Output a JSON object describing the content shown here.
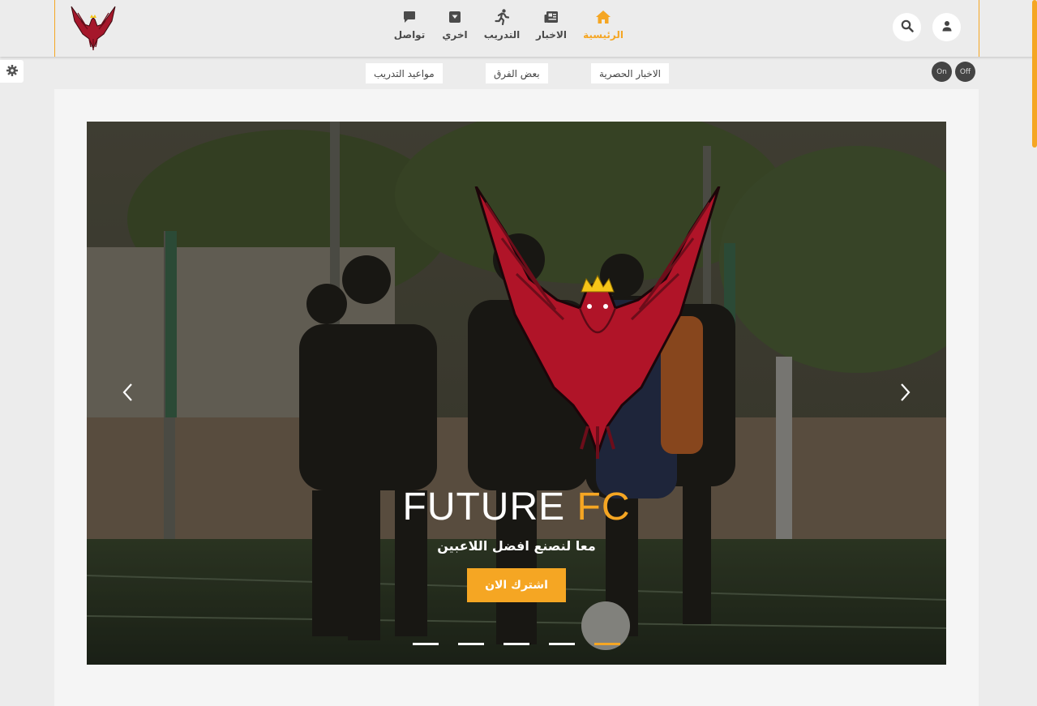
{
  "nav": {
    "items": [
      {
        "label": "الرئيسية",
        "icon": "home-icon",
        "active": true
      },
      {
        "label": "الاخبار",
        "icon": "newspaper-icon",
        "active": false
      },
      {
        "label": "التدريب",
        "icon": "running-icon",
        "active": false
      },
      {
        "label": "اخري",
        "icon": "archive-box-icon",
        "active": false
      },
      {
        "label": "تواصل",
        "icon": "chat-bubble-icon",
        "active": false
      }
    ],
    "search_icon": "search-icon",
    "user_icon": "user-icon",
    "logo": "phoenix-logo"
  },
  "quick_links": [
    "الاخبار الحصرية",
    "بعض الفرق",
    "مواعيد التدريب"
  ],
  "toggle": {
    "on": "On",
    "off": "Off"
  },
  "settings_icon": "gear-icon",
  "hero": {
    "title_main": "FUTURE",
    "title_accent": "FC",
    "subtitle": "معا لنصنع افضل اللاعبين",
    "cta": "اشترك الان",
    "slide_count": 5,
    "active_slide": 5
  },
  "colors": {
    "accent": "#f5a623",
    "text": "#4a4a4a",
    "background": "#ececec",
    "crest_red": "#b01428"
  }
}
